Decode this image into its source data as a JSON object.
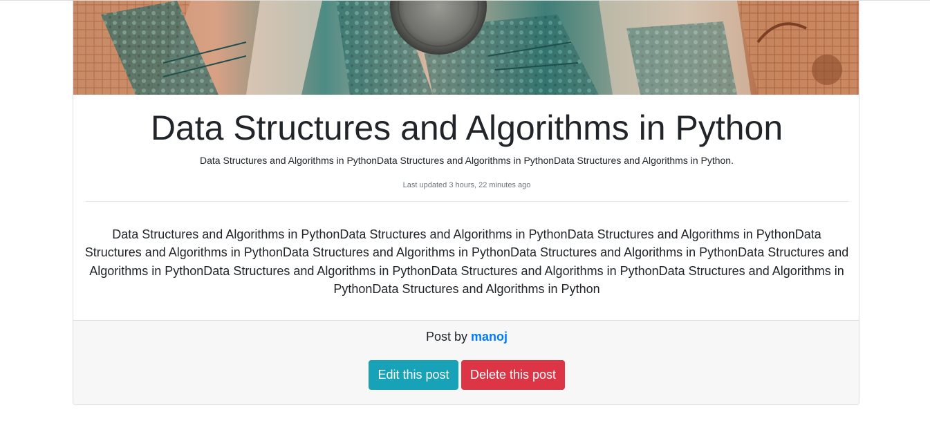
{
  "post": {
    "title": "Data Structures and Algorithms in Python",
    "subtitle": "Data Structures and Algorithms in PythonData Structures and Algorithms in PythonData Structures and Algorithms in Python.",
    "updated": "Last updated 3 hours, 22 minutes ago",
    "content": "Data Structures and Algorithms in PythonData Structures and Algorithms in PythonData Structures and Algorithms in PythonData Structures and Algorithms in PythonData Structures and Algorithms in PythonData Structures and Algorithms in PythonData Structures and Algorithms in PythonData Structures and Algorithms in PythonData Structures and Algorithms in PythonData Structures and Algorithms in PythonData Structures and Algorithms in Python"
  },
  "footer": {
    "post_by_label": "Post by",
    "author": "manoj",
    "edit_label": "Edit this post",
    "delete_label": "Delete this post"
  },
  "colors": {
    "link": "#007bff",
    "edit_button": "#17a2b8",
    "delete_button": "#dc3545",
    "footer_bg": "#f7f7f7",
    "banner_teal": "#2f6d68",
    "banner_orange": "#c98a62"
  }
}
